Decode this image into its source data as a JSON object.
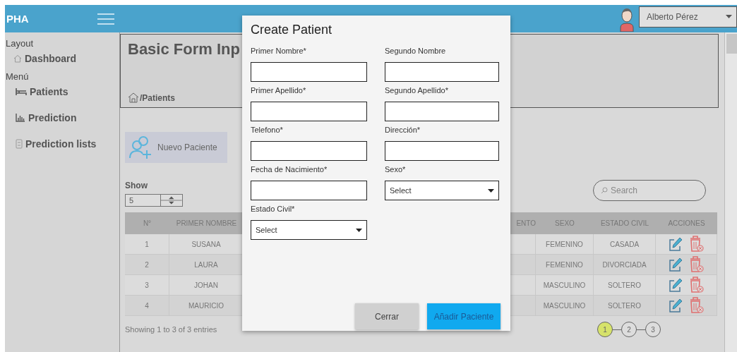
{
  "header": {
    "brand": "PHA",
    "user": "Alberto Pérez"
  },
  "sidebar": {
    "sections": [
      {
        "heading": "Layout",
        "items": [
          {
            "label": "Dashboard"
          }
        ]
      },
      {
        "heading": "Menú",
        "items": [
          {
            "label": "Patients"
          },
          {
            "label": "Prediction"
          },
          {
            "label": "Prediction lists"
          }
        ]
      }
    ]
  },
  "page_header": {
    "title": "Basic Form Inp",
    "breadcrumb": "/Patients"
  },
  "new_button": "Nuevo Paciente",
  "show": {
    "label": "Show",
    "value": "5"
  },
  "search": {
    "placeholder": "Search"
  },
  "table": {
    "columns": [
      "N°",
      "PRIMER NOMBRE",
      "ENTO",
      "SEXO",
      "ESTADO CIVIL",
      "ACCIONES"
    ],
    "rows": [
      {
        "cells": [
          "1",
          "SUSANA",
          "",
          "FEMENINO",
          "CASADA"
        ]
      },
      {
        "cells": [
          "2",
          "LAURA",
          "",
          "FEMENINO",
          "DIVORCIADA"
        ]
      },
      {
        "cells": [
          "3",
          "JOHAN",
          "",
          "MASCULINO",
          "SOLTERO"
        ]
      },
      {
        "cells": [
          "4",
          "MAURICIO",
          "",
          "MASCULINO",
          "SOLTERO"
        ]
      }
    ]
  },
  "footer": "Showing 1 to 3 of 3 entries",
  "pagination": [
    {
      "label": "1",
      "selected": true
    },
    {
      "label": "2",
      "selected": false
    },
    {
      "label": "3",
      "selected": false
    }
  ],
  "modal": {
    "title": "Create Patient",
    "fields": [
      {
        "label": "Primer Nombre*",
        "kind": "text"
      },
      {
        "label": "Segundo Nombre",
        "kind": "text"
      },
      {
        "label": "Primer Apellido*",
        "kind": "text"
      },
      {
        "label": "Segundo Apellido*",
        "kind": "text"
      },
      {
        "label": "Telefono*",
        "kind": "text"
      },
      {
        "label": "Dirección*",
        "kind": "text"
      },
      {
        "label": "Fecha de Nacimiento*",
        "kind": "text"
      },
      {
        "label": "Sexo*",
        "kind": "select",
        "value": "Select"
      },
      {
        "label": "Estado Civil*",
        "kind": "select",
        "value": "Select"
      }
    ],
    "buttons": [
      {
        "label": "Cerrar",
        "kind": "secondary"
      },
      {
        "label": "Añadir Paciente",
        "kind": "primary"
      }
    ]
  }
}
